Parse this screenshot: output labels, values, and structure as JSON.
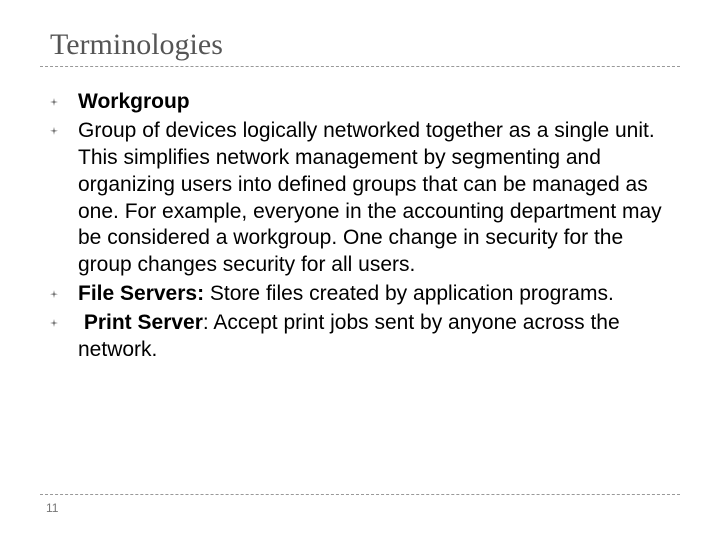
{
  "title": "Terminologies",
  "bullets": {
    "b0": {
      "term": "Workgroup"
    },
    "b1": {
      "text": "Group of devices logically networked together as a single unit. This simplifies network management by segmenting and organizing users into defined groups that can be managed as one. For example, everyone in the accounting department may be considered a workgroup. One change in security for the group changes security for all users."
    },
    "b2": {
      "term": "File Servers:",
      "text": " Store files created by application programs."
    },
    "b3": {
      "term": "Print Server",
      "text": ": Accept print jobs sent by anyone across the network."
    }
  },
  "page_number": "11"
}
